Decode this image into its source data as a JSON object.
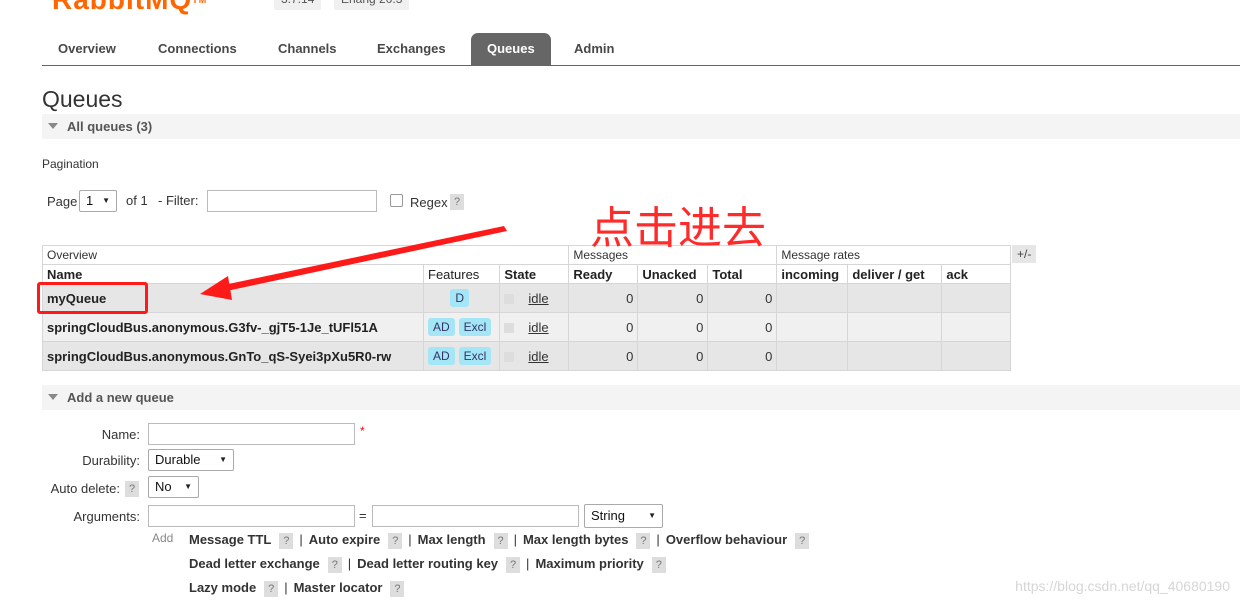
{
  "header": {
    "logo_text": "RabbitMQ",
    "logo_tm": "TM",
    "version": "3.7.14",
    "erlang": "Erlang 20.3"
  },
  "tabs": [
    {
      "label": "Overview",
      "active": false
    },
    {
      "label": "Connections",
      "active": false
    },
    {
      "label": "Channels",
      "active": false
    },
    {
      "label": "Exchanges",
      "active": false
    },
    {
      "label": "Queues",
      "active": true
    },
    {
      "label": "Admin",
      "active": false
    }
  ],
  "page_title": "Queues",
  "all_queues_label": "All queues (3)",
  "pagination": {
    "section_label": "Pagination",
    "page_label": "Page",
    "page_value": "1",
    "of_label": "of 1",
    "filter_label": "- Filter:",
    "filter_value": "",
    "regex_label": "Regex",
    "help": "?"
  },
  "table": {
    "group_overview": "Overview",
    "group_messages": "Messages",
    "group_rates": "Message rates",
    "plus_minus": "+/-",
    "columns": [
      "Name",
      "Features",
      "State",
      "Ready",
      "Unacked",
      "Total",
      "incoming",
      "deliver / get",
      "ack"
    ],
    "rows": [
      {
        "name": "myQueue",
        "features": [
          "D"
        ],
        "state": "idle",
        "ready": "0",
        "unacked": "0",
        "total": "0",
        "incoming": "",
        "deliver_get": "",
        "ack": ""
      },
      {
        "name": "springCloudBus.anonymous.G3fv-_gjT5-1Je_tUFl51A",
        "features": [
          "AD",
          "Excl"
        ],
        "state": "idle",
        "ready": "0",
        "unacked": "0",
        "total": "0",
        "incoming": "",
        "deliver_get": "",
        "ack": ""
      },
      {
        "name": "springCloudBus.anonymous.GnTo_qS-Syei3pXu5R0-rw",
        "features": [
          "AD",
          "Excl"
        ],
        "state": "idle",
        "ready": "0",
        "unacked": "0",
        "total": "0",
        "incoming": "",
        "deliver_get": "",
        "ack": ""
      }
    ]
  },
  "add_queue": {
    "section_label": "Add a new queue",
    "name_label": "Name:",
    "name_value": "",
    "required_mark": "*",
    "durability_label": "Durability:",
    "durability_value": "Durable",
    "auto_delete_label": "Auto delete:",
    "auto_delete_value": "No",
    "arguments_label": "Arguments:",
    "arg_key": "",
    "equals": "=",
    "arg_value": "",
    "arg_type": "String",
    "add_label": "Add",
    "hints_row1": [
      "Message TTL",
      "Auto expire",
      "Max length",
      "Max length bytes",
      "Overflow behaviour"
    ],
    "hints_row2": [
      "Dead letter exchange",
      "Dead letter routing key",
      "Maximum priority"
    ],
    "hints_row3": [
      "Lazy mode",
      "Master locator"
    ],
    "sep": "|",
    "help": "?"
  },
  "annotation": {
    "text": "点击进去",
    "color": "#ff2a2a"
  },
  "watermark": "https://blog.csdn.net/qq_40680190"
}
